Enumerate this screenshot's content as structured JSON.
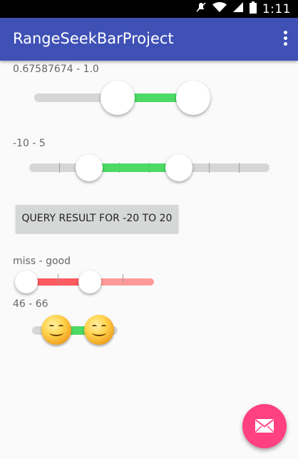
{
  "status_bar": {
    "time": "1:11",
    "icons": [
      "mute-icon",
      "wifi-icon",
      "signal-icon",
      "battery-icon"
    ]
  },
  "app_bar": {
    "title": "RangeSeekBarProject",
    "menu_icon": "overflow-menu-icon"
  },
  "seekbar1": {
    "label": "0.67587674 - 1.0",
    "min_selected": 0.67587674,
    "max_selected": 1.0
  },
  "seekbar2": {
    "label": "-10 - 5",
    "min_selected": -10,
    "max_selected": 5,
    "tick_count": 9
  },
  "query_button": {
    "label": "QUERY RESULT FOR -20 TO 20"
  },
  "seekbar3": {
    "label": "miss - good"
  },
  "seekbar4": {
    "label": "46 - 66",
    "min_selected": 46,
    "max_selected": 66,
    "thumb_icon": "smiley-icon"
  },
  "fab": {
    "icon": "email-icon"
  },
  "colors": {
    "primary": "#3f51b5",
    "accent": "#ff4081",
    "range_green": "#4cd964",
    "range_red": "#ff5a5f",
    "range_pink": "#ff9a9a",
    "track_gray": "#d6d6d6"
  }
}
